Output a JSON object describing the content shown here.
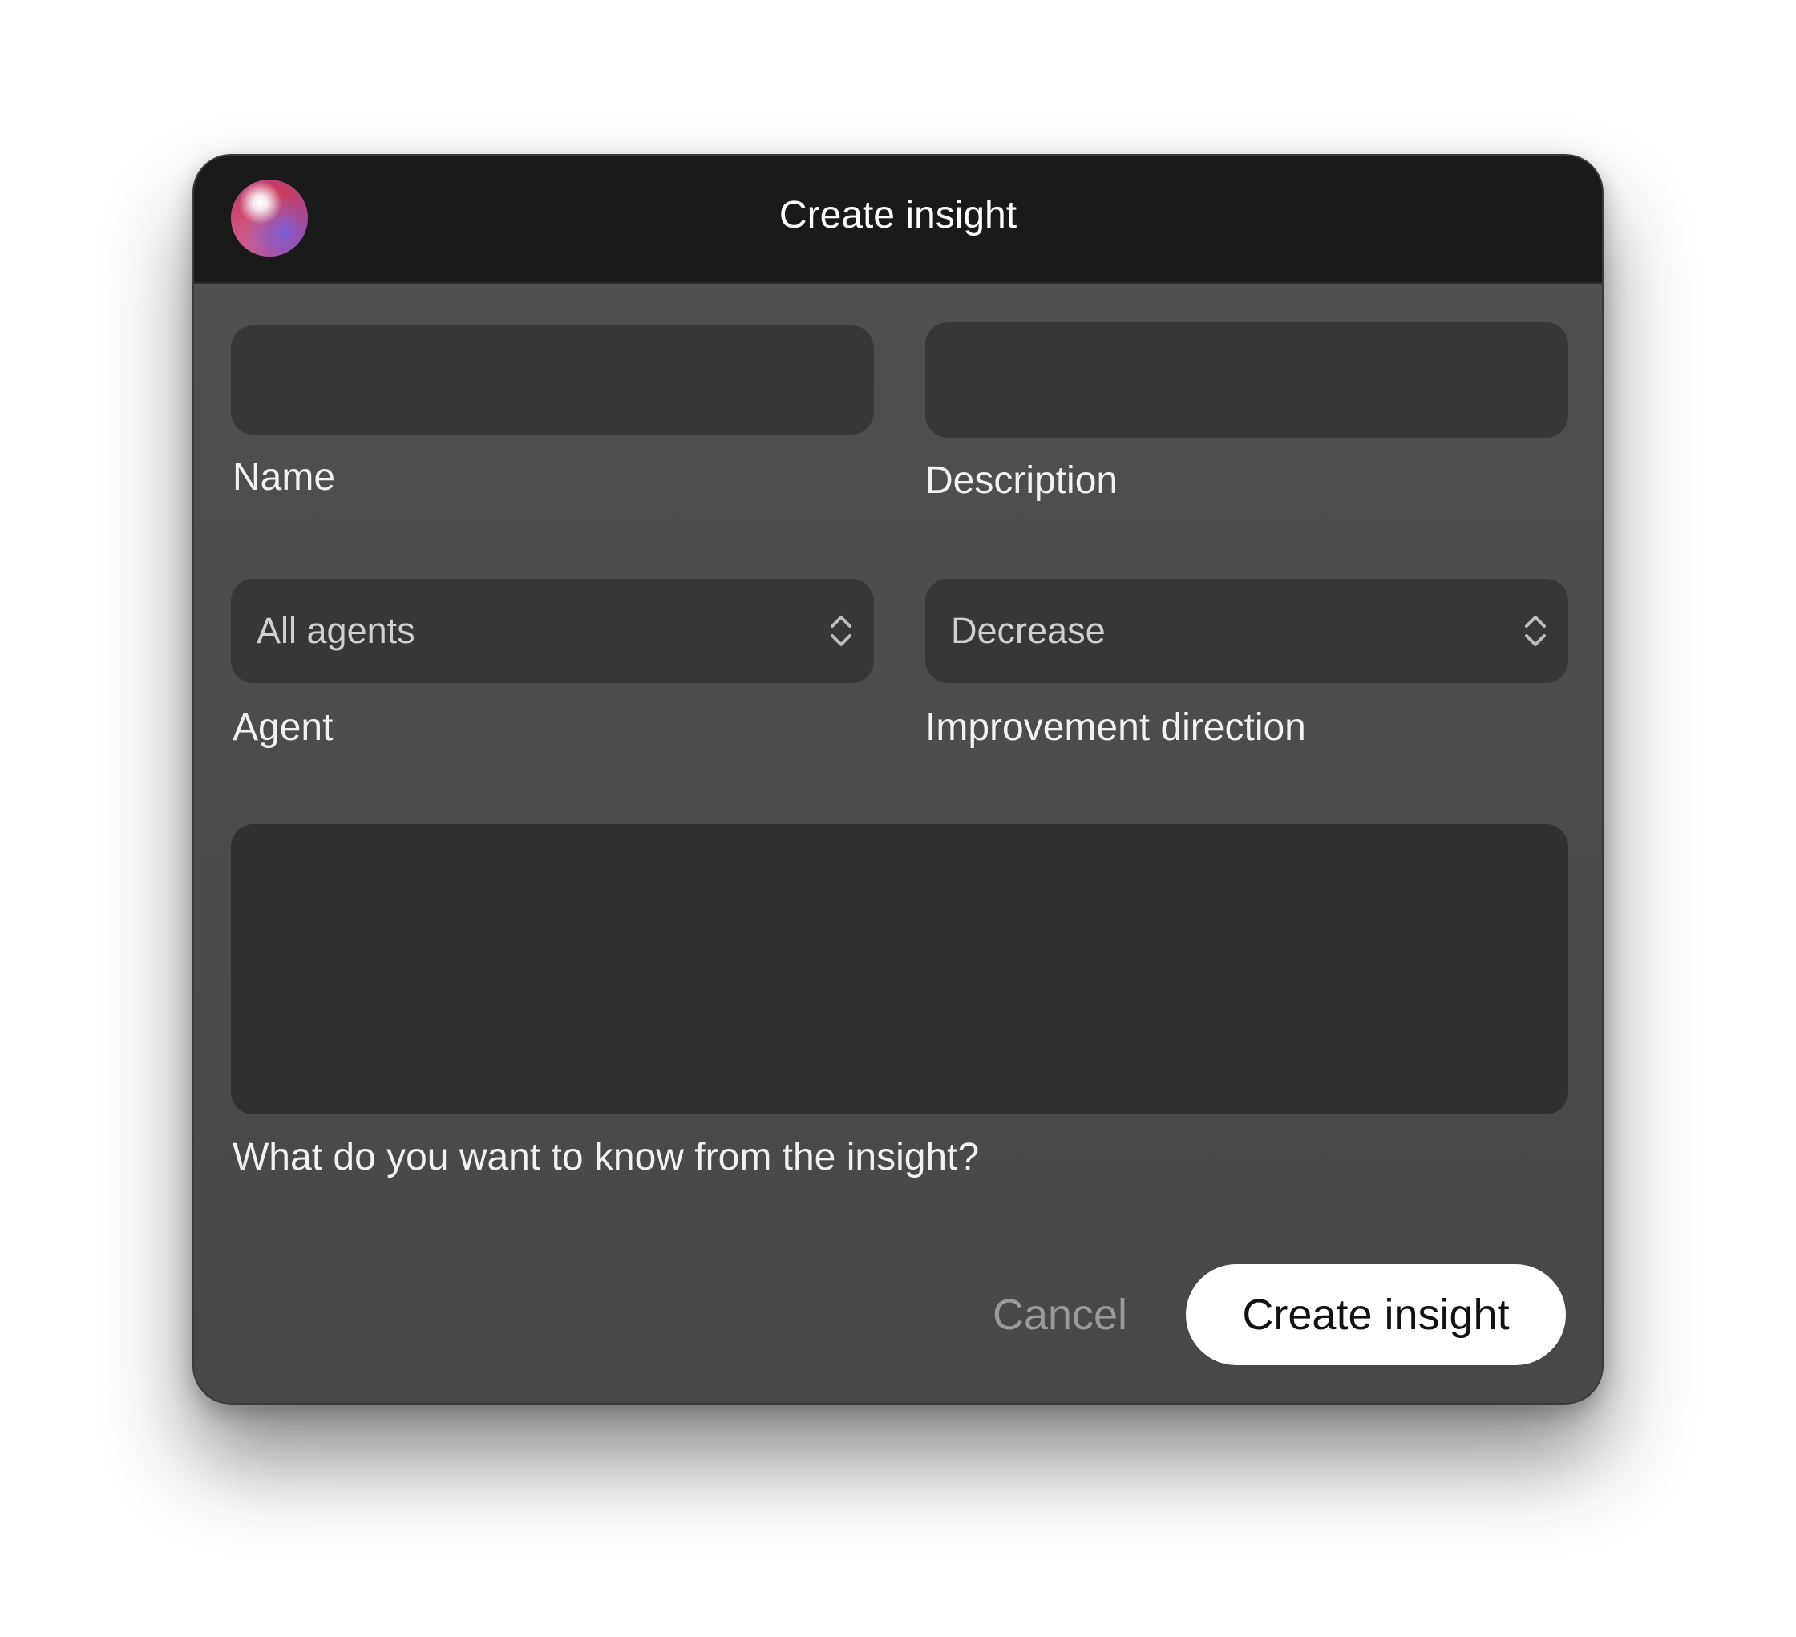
{
  "window": {
    "title": "Create insight"
  },
  "form": {
    "name": {
      "label": "Name",
      "value": ""
    },
    "description": {
      "label": "Description",
      "value": ""
    },
    "agent": {
      "label": "Agent",
      "selected": "All agents"
    },
    "improvement_direction": {
      "label": "Improvement direction",
      "selected": "Decrease"
    },
    "question": {
      "label": "What do you want to know from the insight?",
      "value": ""
    }
  },
  "actions": {
    "cancel_label": "Cancel",
    "submit_label": "Create insight"
  },
  "colors": {
    "titlebar": "#191a19",
    "body": "#4c4d4c",
    "field": "#363736",
    "primary_button": "#ffffff"
  },
  "icons": {
    "app": "gradient-orb-icon",
    "select_stepper": "chevron-up-down-icon"
  }
}
